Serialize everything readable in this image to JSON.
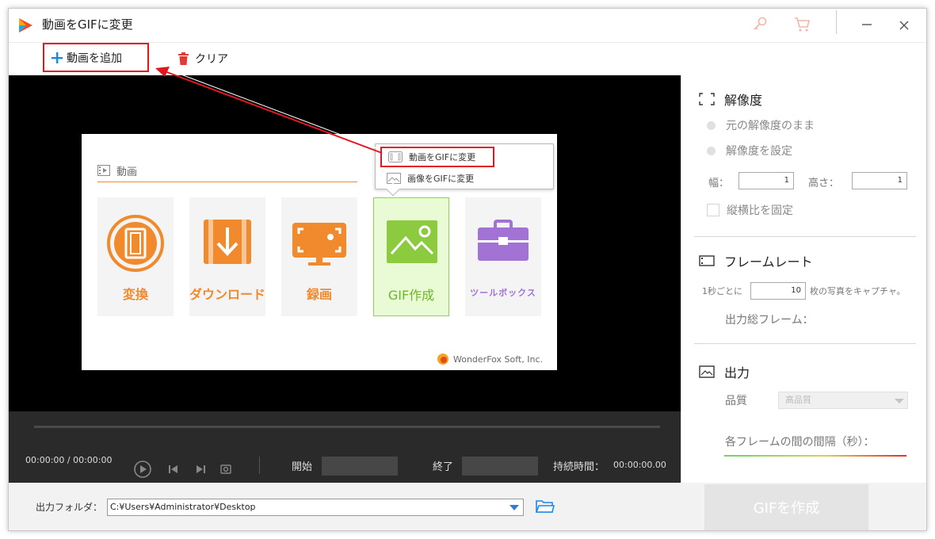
{
  "window": {
    "title": "動画をGIFに変更",
    "icons": [
      "app-logo-icon",
      "key-icon",
      "cart-icon",
      "minimize-icon",
      "close-icon"
    ]
  },
  "toolbar": {
    "add_label": "動画を追加",
    "clear_label": "クリア"
  },
  "preview": {
    "section_title": "動画",
    "tiles": [
      {
        "label": "変換",
        "icon": "film-icon"
      },
      {
        "label": "ダウンロード",
        "icon": "download-icon"
      },
      {
        "label": "録画",
        "icon": "screen-record-icon"
      },
      {
        "label": "GIF作成",
        "icon": "image-icon"
      },
      {
        "label": "ツールボックス",
        "icon": "toolbox-icon"
      }
    ],
    "brand": "WonderFox Soft, Inc.",
    "popup": {
      "item1": "動画をGIFに変更",
      "item2": "画像をGIFに変更"
    }
  },
  "player": {
    "time": "00:00:00  /  00:00:00",
    "start_label": "開始",
    "end_label": "終了",
    "duration_label": "持続時間：",
    "duration_value": "00:00:00.00"
  },
  "panel": {
    "resolution": {
      "title": "解像度",
      "option_original": "元の解像度のまま",
      "option_custom": "解像度を設定",
      "width_label": "幅：",
      "width_value": "1",
      "height_label": "高さ：",
      "height_value": "1",
      "lock_ratio": "縦横比を固定"
    },
    "framerate": {
      "title": "フレームレート",
      "per_second_prefix": "1秒ごとに",
      "fps_value": "10",
      "per_second_suffix": "枚の写真をキャプチャ。",
      "total_frames_label": "出力総フレーム："
    },
    "output": {
      "title": "出力",
      "quality_label": "品質",
      "quality_value": "高品質",
      "interval_label": "各フレームの間の間隔（秒）："
    }
  },
  "footer": {
    "folder_label": "出力フォルダ：",
    "folder_path": "C:¥Users¥Administrator¥Desktop",
    "make_gif_label": "GIFを作成"
  },
  "colors": {
    "accent_orange": "#f08a2c",
    "gif_green": "#92d050",
    "toolbox_purple": "#a273d4",
    "highlight_red": "#e1161e"
  }
}
